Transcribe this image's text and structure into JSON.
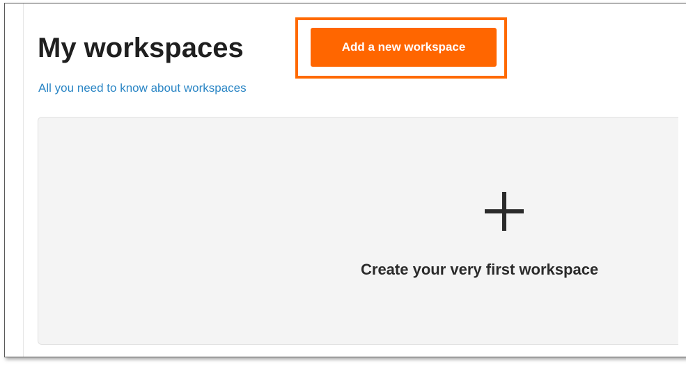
{
  "header": {
    "title": "My workspaces",
    "add_button_label": "Add a new workspace",
    "info_link": "All you need to know about workspaces"
  },
  "empty_state": {
    "icon": "plus-icon",
    "label": "Create your very first workspace"
  },
  "colors": {
    "accent": "#ff6600",
    "highlight_border": "#ff6a00",
    "link": "#2b86c5",
    "card_background": "#f4f4f4"
  }
}
